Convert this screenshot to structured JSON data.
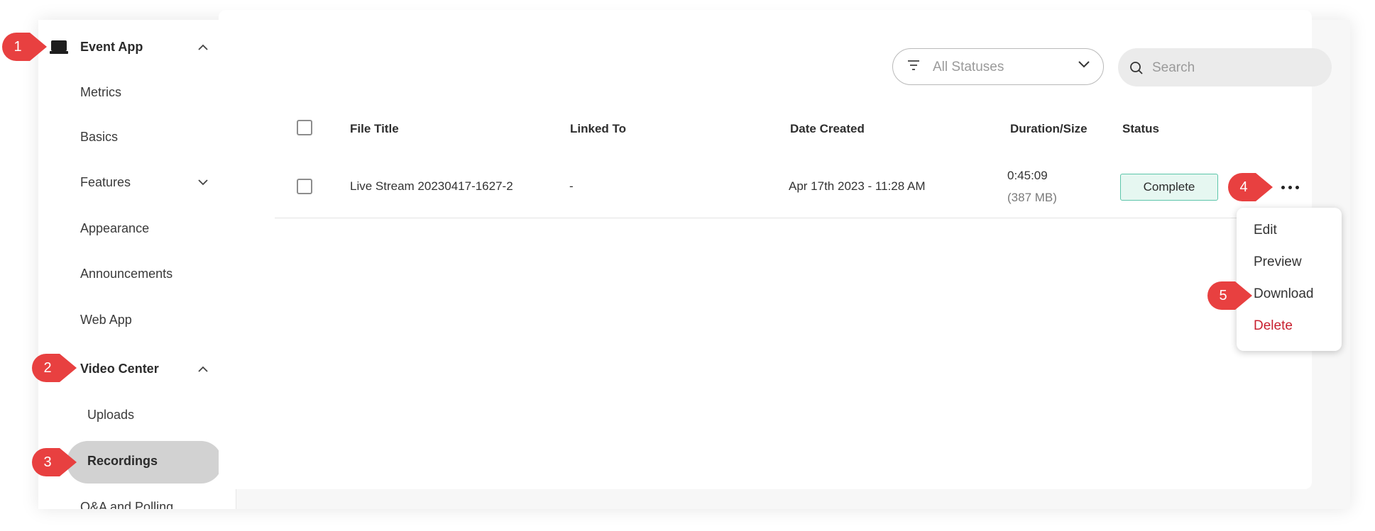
{
  "sidebar": {
    "items": [
      {
        "label": "Event App",
        "type": "section",
        "expanded": true
      },
      {
        "label": "Metrics"
      },
      {
        "label": "Basics"
      },
      {
        "label": "Features",
        "expandable": true
      },
      {
        "label": "Appearance"
      },
      {
        "label": "Announcements"
      },
      {
        "label": "Web App"
      },
      {
        "label": "Video Center",
        "type": "section",
        "expanded": true
      },
      {
        "label": "Uploads"
      },
      {
        "label": "Recordings",
        "active": true
      },
      {
        "label": "Q&A and Polling"
      }
    ],
    "collapse_icon": "chevron-left-icon"
  },
  "toolbar": {
    "filter_label": "All Statuses",
    "search_placeholder": "Search"
  },
  "table": {
    "columns": [
      "File Title",
      "Linked To",
      "Date Created",
      "Duration/Size",
      "Status"
    ],
    "rows": [
      {
        "title": "Live Stream 20230417-1627-2",
        "linked_to": "-",
        "date_created": "Apr 17th 2023 - 11:28 AM",
        "duration": "0:45:09",
        "size": "(387 MB)",
        "status": "Complete"
      }
    ]
  },
  "context_menu": {
    "items": [
      "Edit",
      "Preview",
      "Download",
      "Delete"
    ]
  },
  "callouts": [
    "1",
    "2",
    "3",
    "4",
    "5"
  ],
  "colors": {
    "callout": "#e84040",
    "status_complete_border": "#5cc5aa",
    "status_complete_bg": "#e6f7f1",
    "danger": "#c8202f",
    "active_pill": "#d2d2d2"
  }
}
